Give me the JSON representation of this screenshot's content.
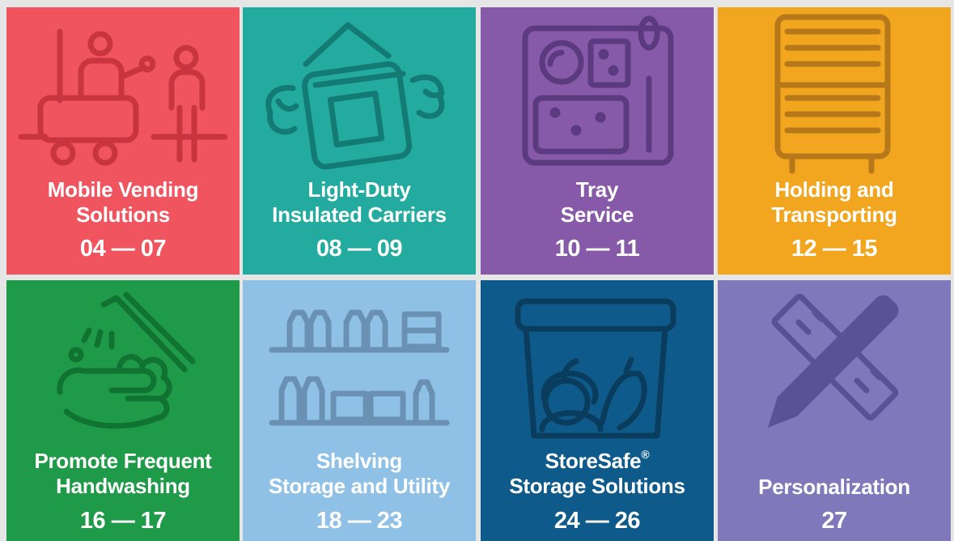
{
  "colors": {
    "red": "#f0545f",
    "red_icon": "#c9353f",
    "teal": "#24aba0",
    "teal_icon": "#137b73",
    "purple": "#865aa8",
    "purple_icon": "#5c3a7f",
    "orange": "#f2a51e",
    "orange_icon": "#b7781a",
    "green": "#1f9a49",
    "green_icon": "#117331",
    "lightblue": "#8fc1e6",
    "lightblue_icon": "#6a91b3",
    "navy": "#0e5a8a",
    "navy_icon": "#0a3c5d",
    "lavender": "#7f78bb",
    "lavender_icon": "#5a5196"
  },
  "tiles": [
    {
      "title_line1": "Mobile Vending",
      "title_line2": "Solutions",
      "pages": "04 — 07",
      "icon": "vending-cart-icon"
    },
    {
      "title_line1": "Light-Duty",
      "title_line2": "Insulated Carriers",
      "pages": "08 — 09",
      "icon": "insulated-carrier-icon"
    },
    {
      "title_line1": "Tray",
      "title_line2": "Service",
      "pages": "10 — 11",
      "icon": "meal-tray-icon"
    },
    {
      "title_line1": "Holding and",
      "title_line2": "Transporting",
      "pages": "12 — 15",
      "icon": "holding-cabinet-icon"
    },
    {
      "title_line1": "Promote Frequent",
      "title_line2": "Handwashing",
      "pages": "16 — 17",
      "icon": "handwashing-icon"
    },
    {
      "title_line1": "Shelving",
      "title_line2": "Storage and Utility",
      "pages": "18 — 23",
      "icon": "shelving-icon"
    },
    {
      "title_line1": "StoreSafe",
      "title_sup": "®",
      "title_line2": "Storage Solutions",
      "pages": "24 — 26",
      "icon": "storage-container-icon"
    },
    {
      "title_line1": "Personalization",
      "pages": "27",
      "icon": "pencil-ruler-icon"
    }
  ]
}
